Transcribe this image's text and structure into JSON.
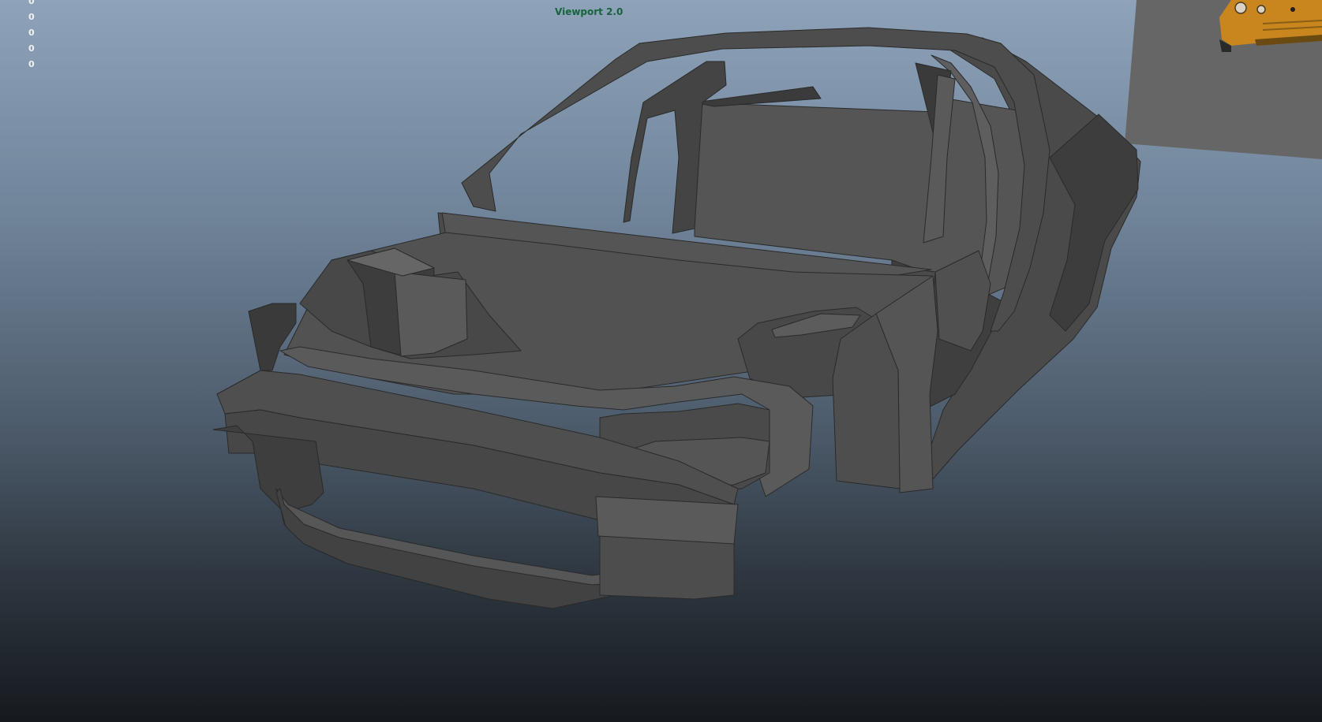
{
  "viewport": {
    "renderer_label": "Viewport 2.0",
    "hud_stats": [
      "0",
      "0",
      "0",
      "0",
      "0"
    ],
    "background_top": "#8ea3b9",
    "background_bottom": "#161a1f"
  },
  "scene": {
    "model": "car-body-shell",
    "model_color": "#555555",
    "reference_image_color": "#c9861e"
  }
}
